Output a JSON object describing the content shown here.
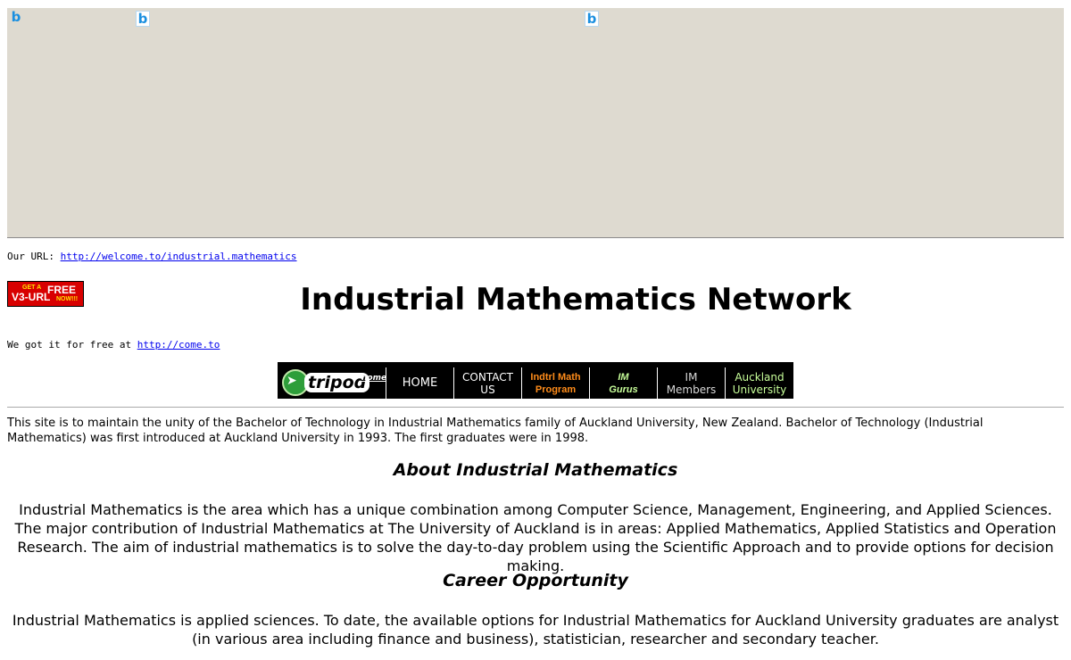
{
  "ad": {
    "icons": [
      "bing-b-icon",
      "bing-b-icon",
      "bing-b-icon"
    ],
    "icon_glyph": "b"
  },
  "url_line": {
    "prefix": "Our URL: ",
    "link": "http://welcome.to/industrial.mathematics"
  },
  "badge": {
    "line1": "GET A",
    "line2": "V3-URL",
    "line3": "FREE",
    "line4": "NOW!!!"
  },
  "title": "Industrial Mathematics Network",
  "free_line": {
    "prefix": "We got it for free at ",
    "link": "http://come.to"
  },
  "nav": {
    "logo_word": "tripod",
    "logo_home": "home",
    "home": "HOME",
    "contact_line1": "CONTACT",
    "contact_line2": "US",
    "program_line1": "Indtrl Math",
    "program_line2": "Program",
    "gurus_line1": "IM",
    "gurus_line2": "Gurus",
    "members_line1": "IM",
    "members_line2": "Members",
    "auckland_line1": "Auckland",
    "auckland_line2": "University"
  },
  "intro": "This site is to maintain the unity of the Bachelor of Technology in Industrial Mathematics family of Auckland University, New Zealand. Bachelor of Technology (Industrial Mathematics) was first introduced at Auckland University in 1993. The first graduates were in 1998.",
  "about": {
    "heading": "About Industrial Mathematics",
    "text": "Industrial Mathematics is the area which has a unique combination among Computer Science, Management, Engineering, and Applied Sciences. The major contribution of Industrial Mathematics at The University of Auckland is in areas: Applied Mathematics, Applied Statistics and Operation Research. The aim of industrial mathematics is to solve the day-to-day problem using the Scientific Approach and to provide options for decision making."
  },
  "career": {
    "heading": "Career Opportunity",
    "text": "Industrial Mathematics is applied sciences. To date, the available options for Industrial Mathematics for Auckland University graduates are analyst (in various area including finance and business), statistician, researcher and secondary teacher."
  },
  "colors": {
    "ad_background": "#dedad0",
    "link": "#0000ee",
    "nav_background": "#000000",
    "program_text": "#ff8c1a",
    "gurus_text": "#c8ff9a"
  }
}
